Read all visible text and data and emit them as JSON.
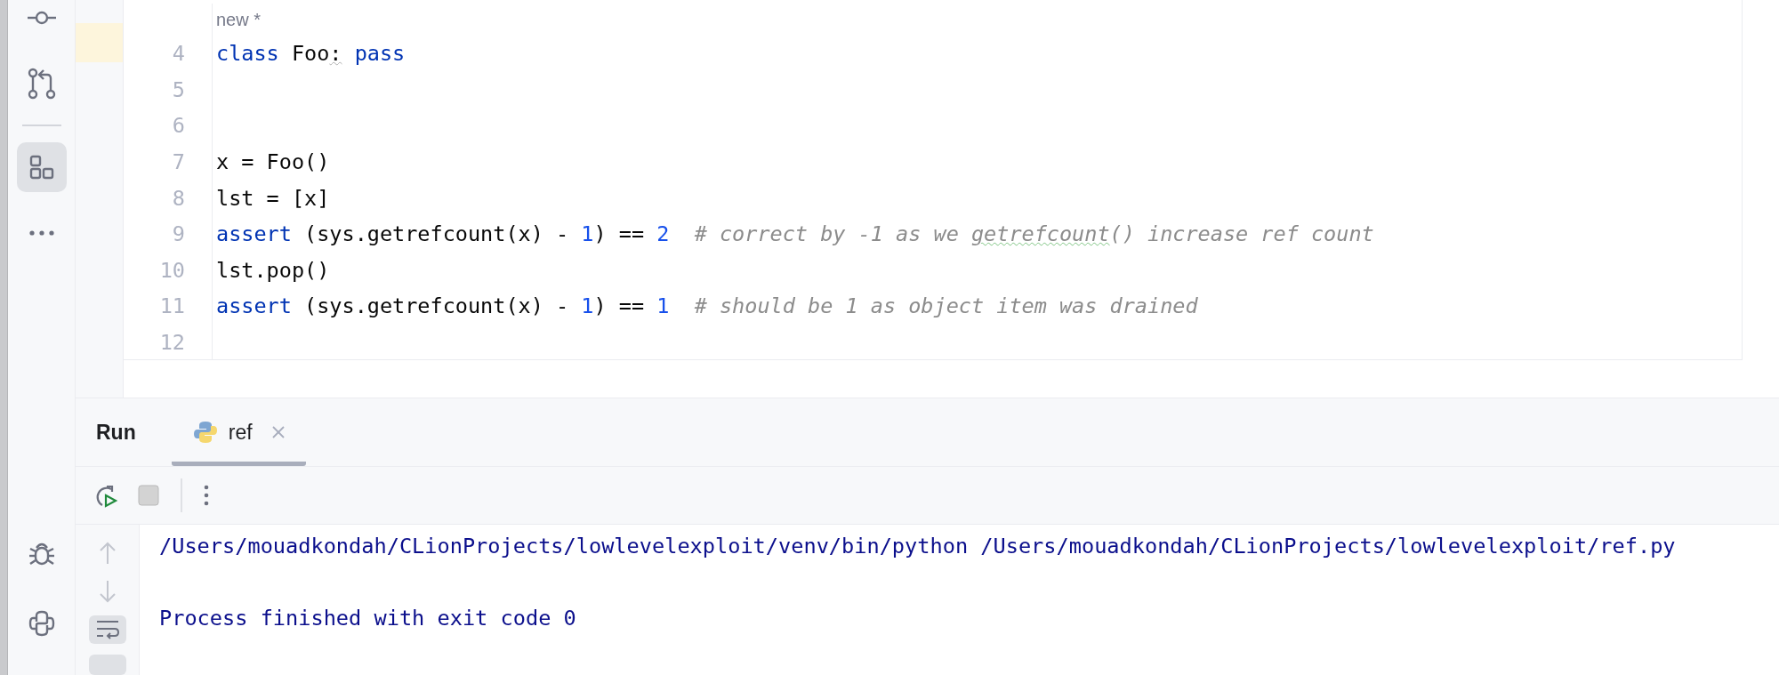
{
  "sidebar": {
    "items": [
      {
        "kind": "commit",
        "selected": false
      },
      {
        "kind": "pull-request",
        "selected": false
      },
      {
        "kind": "structure",
        "selected": true
      },
      {
        "kind": "more",
        "selected": false
      }
    ],
    "bottom_items": [
      {
        "kind": "debug",
        "selected": false
      },
      {
        "kind": "python",
        "selected": false
      }
    ]
  },
  "editor": {
    "header": "new *",
    "lines": [
      {
        "number": "4",
        "tokens": [
          {
            "kind": "keyword",
            "text": "class"
          },
          {
            "kind": "plain",
            "text": " Foo"
          },
          {
            "kind": "warning",
            "text": ":"
          },
          {
            "kind": "keyword",
            "text": " pass"
          }
        ]
      },
      {
        "number": "5"
      },
      {
        "number": "6"
      },
      {
        "number": "7",
        "tokens": [
          {
            "kind": "plain",
            "text": "x = Foo()"
          }
        ]
      },
      {
        "number": "8",
        "tokens": [
          {
            "kind": "plain",
            "text": "lst = [x]"
          }
        ]
      },
      {
        "number": "9",
        "tokens": [
          {
            "kind": "keyword",
            "text": "assert"
          },
          {
            "kind": "plain",
            "text": " (sys.getrefcount(x) - "
          },
          {
            "kind": "number",
            "text": "1"
          },
          {
            "kind": "plain",
            "text": ") == "
          },
          {
            "kind": "number",
            "text": "2"
          },
          {
            "kind": "comment",
            "text": "  # correct by -1 as we "
          },
          {
            "kind": "typo-comment",
            "text": "getrefcount"
          },
          {
            "kind": "comment",
            "text": "() increase ref count"
          }
        ]
      },
      {
        "number": "10",
        "tokens": [
          {
            "kind": "plain",
            "text": "lst.pop()"
          }
        ]
      },
      {
        "number": "11",
        "tokens": [
          {
            "kind": "keyword",
            "text": "assert"
          },
          {
            "kind": "plain",
            "text": " (sys.getrefcount(x) - "
          },
          {
            "kind": "number",
            "text": "1"
          },
          {
            "kind": "plain",
            "text": ") == "
          },
          {
            "kind": "number",
            "text": "1"
          },
          {
            "kind": "comment",
            "text": "  # should be 1 as object item was drained"
          }
        ]
      },
      {
        "number": "12"
      }
    ]
  },
  "run_panel": {
    "title": "Run",
    "tabs": [
      {
        "label": "ref",
        "selected": true
      }
    ],
    "toolbar": [
      {
        "kind": "rerun"
      },
      {
        "kind": "stop"
      },
      {
        "kind": "separator"
      },
      {
        "kind": "more"
      }
    ],
    "console_tools": [
      {
        "kind": "up",
        "selected": false
      },
      {
        "kind": "down",
        "selected": false
      },
      {
        "kind": "soft-wrap",
        "selected": true
      }
    ],
    "console": [
      "/Users/mouadkondah/CLionProjects/lowlevelexploit/venv/bin/python /Users/mouadkondah/CLionProjects/lowlevelexploit/ref.py",
      "Process finished with exit code 0"
    ]
  }
}
